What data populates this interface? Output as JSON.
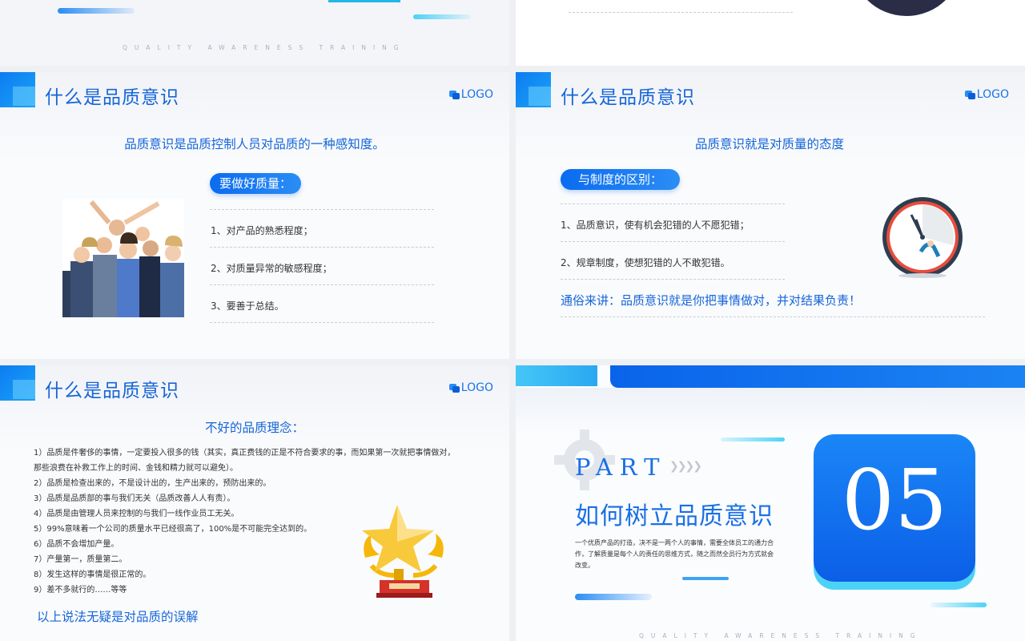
{
  "top_left": {
    "tagline": "QUALITY AWARENESS TRAINING"
  },
  "slide_a": {
    "title": "什么是品质意识",
    "logo": "LOGO",
    "definition": "品质意识是品质控制人员对品质的一种感知度。",
    "pill": "要做好质量：",
    "items": [
      "1、对产品的熟悉程度；",
      "2、对质量异常的敏感程度；",
      "3、要善于总结。"
    ]
  },
  "slide_b": {
    "title": "什么是品质意识",
    "logo": "LOGO",
    "definition": "品质意识就是对质量的态度",
    "pill": "与制度的区别：",
    "items": [
      "1、品质意识，使有机会犯错的人不愿犯错；",
      "2、规章制度，使想犯错的人不敢犯错。"
    ],
    "summary": "通俗来讲：品质意识就是你把事情做对，并对结果负责！"
  },
  "slide_c": {
    "title": "什么是品质意识",
    "logo": "LOGO",
    "heading": "不好的品质理念：",
    "lines": [
      "1）品质是件奢侈的事情，一定要投入很多的钱（其实，真正费钱的正是不符合要求的事，而如果第一次就把事情做对，",
      "那些浪费在补救工作上的时间、金钱和精力就可以避免）。",
      "2）品质是检查出来的，不是设计出的，生产出来的，预防出来的。",
      "3）品质是品质部的事与我们无关（品质改善人人有责）。",
      "4）品质是由管理人员来控制的与我们一线作业员工无关。",
      "5）99%意味着一个公司的质量水平已经很高了，100%是不可能完全达到的。",
      "6）品质不会增加产量。",
      "7）产量第一，质量第二。",
      "8）发生这样的事情是很正常的。",
      "9）差不多就行的……等等"
    ],
    "conclusion": "以上说法无疑是对品质的误解"
  },
  "slide_d": {
    "part_label": "PART",
    "arrows": "❯❯❯❯",
    "title": "如何树立品质意识",
    "body_lines": [
      "一个优质产品的打造，决不是一两个人的事情，需要全体员工的通力合",
      "作，了解质量是每个人的责任的思维方式，随之而然全员行为方式就会",
      "改变。"
    ],
    "number": "05",
    "tagline": "QUALITY AWARENESS TRAINING"
  },
  "colors": {
    "accent": "#1565d8",
    "pill": "#0a6cf0",
    "badge": "#1a7cf5"
  }
}
